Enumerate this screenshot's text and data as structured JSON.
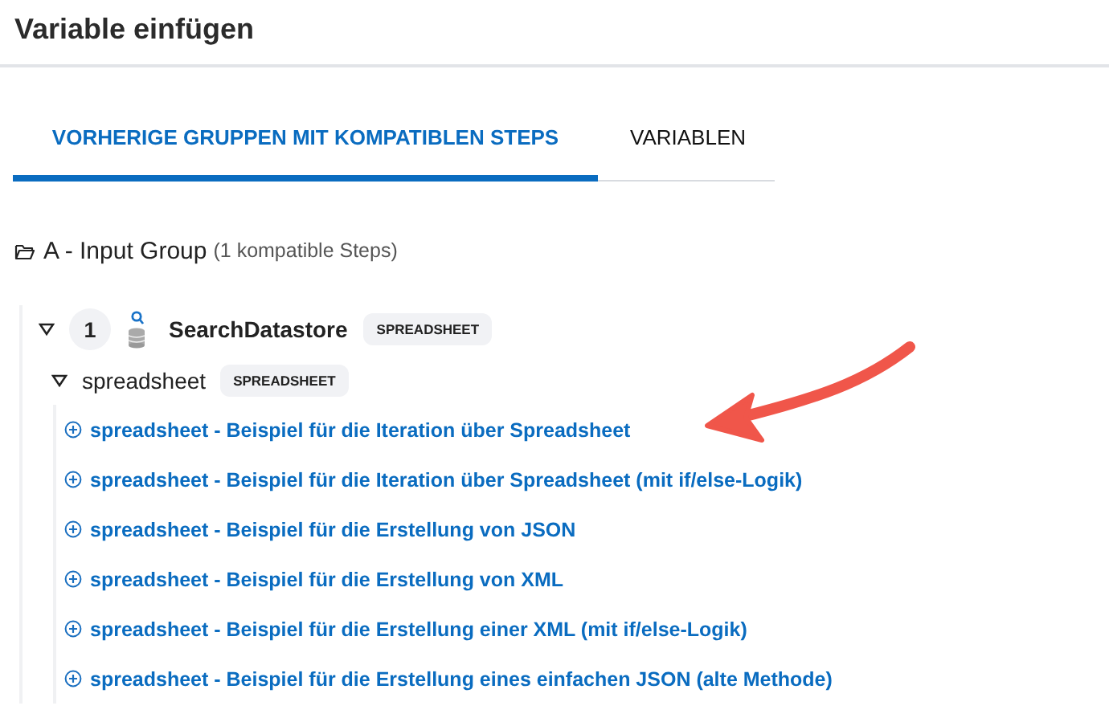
{
  "dialog": {
    "title": "Variable einfügen"
  },
  "tabs": [
    {
      "label": "VORHERIGE GRUPPEN MIT KOMPATIBLEN STEPS",
      "selected": true
    },
    {
      "label": "VARIABLEN",
      "selected": false
    }
  ],
  "groups": [
    {
      "name": "A - Input Group",
      "count": "(1 kompatible Steps)",
      "steps": [
        {
          "number": "1",
          "name": "SearchDatastore",
          "tag": "SPREADSHEET",
          "expanded": true,
          "outputs": [
            {
              "name": "spreadsheet",
              "tag": "SPREADSHEET",
              "expanded": true,
              "items": [
                "spreadsheet - Beispiel für die Iteration über Spreadsheet",
                "spreadsheet - Beispiel für die Iteration über Spreadsheet (mit if/else-Logik)",
                "spreadsheet - Beispiel für die Erstellung von JSON",
                "spreadsheet - Beispiel für die Erstellung von XML",
                "spreadsheet - Beispiel für die Erstellung einer XML (mit if/else-Logik)",
                "spreadsheet - Beispiel für die Erstellung eines einfachen JSON (alte Methode)"
              ]
            }
          ]
        }
      ]
    }
  ],
  "annotations": [
    {
      "kind": "arrow"
    }
  ]
}
